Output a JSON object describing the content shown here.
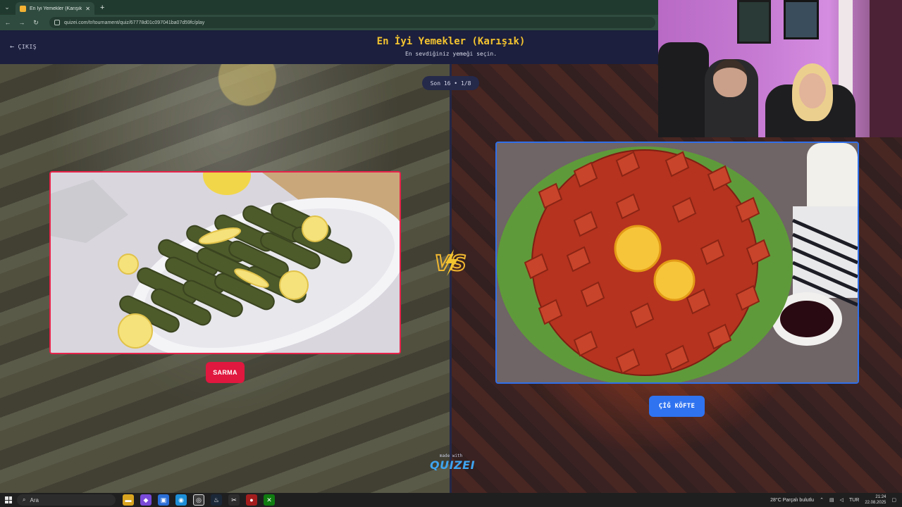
{
  "browser": {
    "tab_title": "En İyi Yemekler (Karışık) - Quizei",
    "tab_close": "✕",
    "new_tab": "+",
    "url": "quizei.com/tr/tournament/quiz/67778d01c097041ba07d59fc/play"
  },
  "header": {
    "exit_label": "ÇIKIŞ",
    "title": "En İyi Yemekler (Karışık)",
    "subtitle": "En sevdiğiniz yemeği seçin."
  },
  "round": {
    "label": "Son 16 • 1/8"
  },
  "left_option": {
    "name": "SARMA",
    "accent": "#e0173f"
  },
  "right_option": {
    "name": "ÇİĞ KÖFTE",
    "accent": "#2f73f0"
  },
  "vs_label": "VS",
  "branding": {
    "made_with": "made with",
    "logo": "QUIZEI"
  },
  "taskbar": {
    "search_placeholder": "Ara",
    "weather": "28°C  Parçalı bulutlu",
    "language": "TUR",
    "time": "21:24",
    "date": "22.08.2025"
  }
}
